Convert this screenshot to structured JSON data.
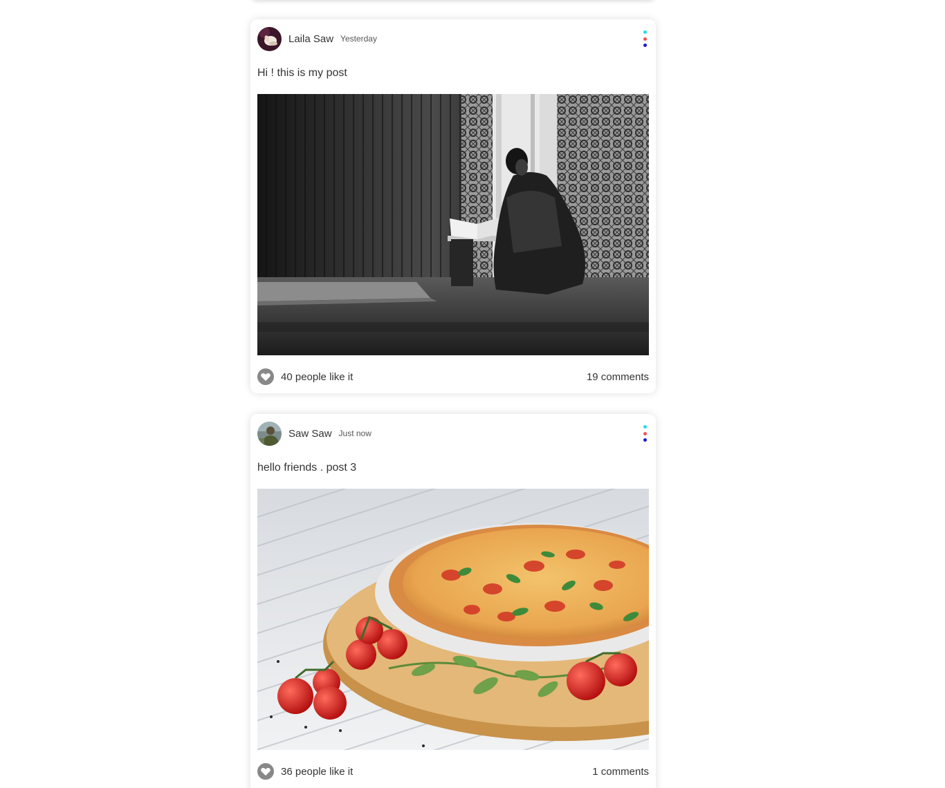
{
  "colors": {
    "dot_top": "#2ad9f0",
    "dot_middle": "#f0525b",
    "dot_bottom": "#1a1ad6",
    "like_icon_bg": "#888888"
  },
  "posts": [
    {
      "username": "Laila Saw",
      "date": "Yesterday",
      "text": "Hi ! this is my post",
      "likes": "40 people like it",
      "comments": "19 comments",
      "icons": {
        "more": "more-vert-icon",
        "like": "heart-icon"
      }
    },
    {
      "username": "Saw Saw",
      "date": "Just now",
      "text": "hello friends . post 3",
      "likes": "36 people like it",
      "comments": "1 comments",
      "icons": {
        "more": "more-vert-icon",
        "like": "heart-icon"
      }
    }
  ]
}
